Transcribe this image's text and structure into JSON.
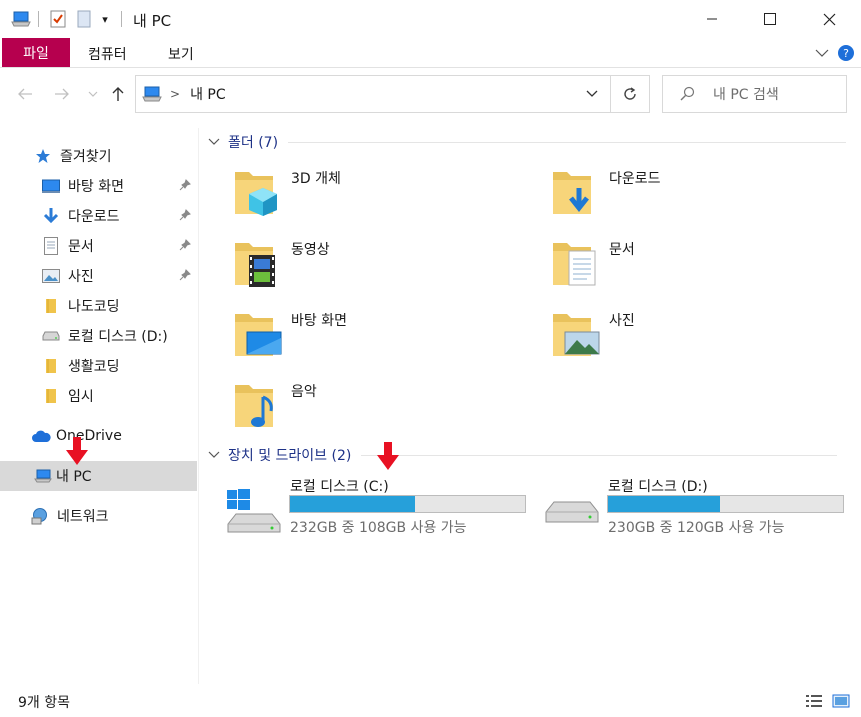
{
  "window": {
    "title": "내 PC",
    "qat_dropdown_glyph": "▾"
  },
  "ribbon": {
    "file_tab": "파일",
    "tabs": [
      "컴퓨터",
      "보기"
    ]
  },
  "address": {
    "path_sep": ">",
    "path": "내 PC",
    "search_placeholder": "내 PC 검색"
  },
  "nav": {
    "quick_access": "즐겨찾기",
    "quick_items": [
      {
        "label": "바탕 화면",
        "icon": "desktop-icon",
        "pinned": true
      },
      {
        "label": "다운로드",
        "icon": "download-icon",
        "pinned": true
      },
      {
        "label": "문서",
        "icon": "document-icon",
        "pinned": true
      },
      {
        "label": "사진",
        "icon": "picture-icon",
        "pinned": true
      },
      {
        "label": "나도코딩",
        "icon": "folder-icon",
        "pinned": false
      },
      {
        "label": "로컬 디스크 (D:)",
        "icon": "drive-icon",
        "pinned": false
      },
      {
        "label": "생활코딩",
        "icon": "folder-icon",
        "pinned": false
      },
      {
        "label": "임시",
        "icon": "folder-icon",
        "pinned": false
      }
    ],
    "onedrive": "OneDrive",
    "this_pc": "내 PC",
    "network": "네트워크"
  },
  "content": {
    "folders_header": "폴더 (7)",
    "folders": [
      {
        "name": "3D 개체",
        "icon": "3d-objects-folder-icon"
      },
      {
        "name": "다운로드",
        "icon": "downloads-folder-icon"
      },
      {
        "name": "동영상",
        "icon": "videos-folder-icon"
      },
      {
        "name": "문서",
        "icon": "documents-folder-icon"
      },
      {
        "name": "바탕 화면",
        "icon": "desktop-folder-icon"
      },
      {
        "name": "사진",
        "icon": "pictures-folder-icon"
      },
      {
        "name": "음악",
        "icon": "music-folder-icon"
      }
    ],
    "drives_header": "장치 및 드라이브 (2)",
    "drives": [
      {
        "name": "로컬 디스크 (C:)",
        "free_text": "232GB 중 108GB 사용 가능",
        "used_fraction": 0.534,
        "icon": "windows-drive-icon"
      },
      {
        "name": "로컬 디스크 (D:)",
        "free_text": "230GB 중 120GB 사용 가능",
        "used_fraction": 0.478,
        "icon": "drive-icon"
      }
    ]
  },
  "status": {
    "item_count": "9개 항목"
  },
  "colors": {
    "file_tab": "#b6004e",
    "progress": "#26a0da",
    "group_header": "#1e3287",
    "selected_nav": "#d9d9d9",
    "annotation_arrow": "#e81123"
  }
}
